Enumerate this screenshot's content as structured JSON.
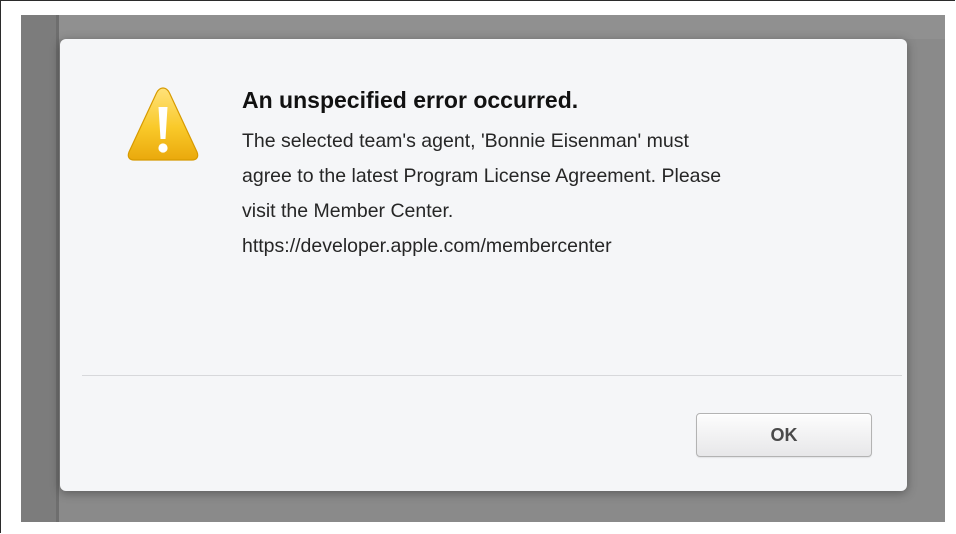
{
  "dialog": {
    "icon": "warning-triangle-icon",
    "title": "An unspecified error occurred.",
    "message_lines": [
      "The selected team's agent, 'Bonnie Eisenman' must",
      "agree to the latest Program License Agreement. Please",
      "visit the Member Center.",
      "https://developer.apple.com/membercenter"
    ],
    "ok_label": "OK"
  },
  "colors": {
    "backdrop": "#8a8a8a",
    "dialog_bg": "#f5f6f8",
    "warning_yellow": "#f7c21a",
    "title_text": "#111111"
  }
}
